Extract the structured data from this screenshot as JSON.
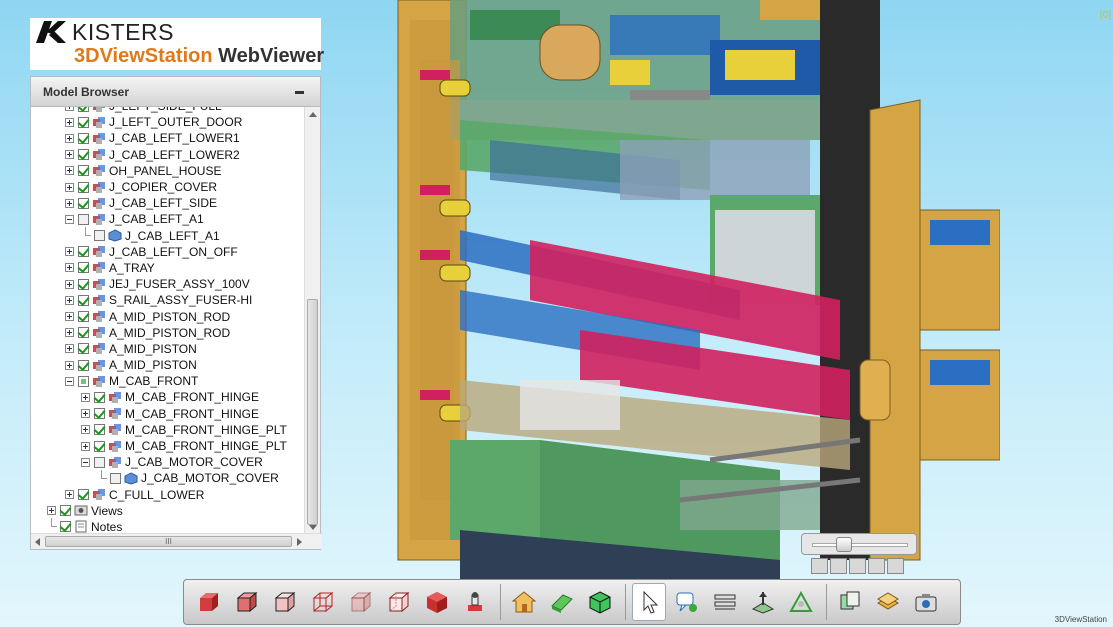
{
  "logo": {
    "brand": "KISTERS",
    "product_part1": "3DViewStation",
    "product_part2": " WebViewer"
  },
  "model_browser": {
    "title": "Model Browser",
    "items": [
      {
        "label": "J_LEFT_SIDE_FULL",
        "depth": 0,
        "expander": "plus",
        "check": "on",
        "icon": "assembly-icon"
      },
      {
        "label": "J_LEFT_OUTER_DOOR",
        "depth": 0,
        "expander": "plus",
        "check": "on",
        "icon": "assembly-icon"
      },
      {
        "label": "J_CAB_LEFT_LOWER1",
        "depth": 0,
        "expander": "plus",
        "check": "on",
        "icon": "assembly-icon"
      },
      {
        "label": "J_CAB_LEFT_LOWER2",
        "depth": 0,
        "expander": "plus",
        "check": "on",
        "icon": "assembly-icon"
      },
      {
        "label": "OH_PANEL_HOUSE",
        "depth": 0,
        "expander": "plus",
        "check": "on",
        "icon": "assembly-icon"
      },
      {
        "label": "J_COPIER_COVER",
        "depth": 0,
        "expander": "plus",
        "check": "on",
        "icon": "assembly-icon"
      },
      {
        "label": "J_CAB_LEFT_SIDE",
        "depth": 0,
        "expander": "plus",
        "check": "on",
        "icon": "assembly-icon"
      },
      {
        "label": "J_CAB_LEFT_A1",
        "depth": 0,
        "expander": "minus",
        "check": "off",
        "icon": "assembly-icon"
      },
      {
        "label": "J_CAB_LEFT_A1",
        "depth": 1,
        "expander": "leaf",
        "check": "off",
        "icon": "part-icon"
      },
      {
        "label": "J_CAB_LEFT_ON_OFF",
        "depth": 0,
        "expander": "plus",
        "check": "on",
        "icon": "assembly-icon"
      },
      {
        "label": "A_TRAY",
        "depth": 0,
        "expander": "plus",
        "check": "on",
        "icon": "assembly-icon"
      },
      {
        "label": "JEJ_FUSER_ASSY_100V",
        "depth": 0,
        "expander": "plus",
        "check": "on",
        "icon": "assembly-icon"
      },
      {
        "label": "S_RAIL_ASSY_FUSER-HI",
        "depth": 0,
        "expander": "plus",
        "check": "on",
        "icon": "assembly-icon"
      },
      {
        "label": "A_MID_PISTON_ROD",
        "depth": 0,
        "expander": "plus",
        "check": "on",
        "icon": "assembly-icon"
      },
      {
        "label": "A_MID_PISTON_ROD",
        "depth": 0,
        "expander": "plus",
        "check": "on",
        "icon": "assembly-icon"
      },
      {
        "label": "A_MID_PISTON",
        "depth": 0,
        "expander": "plus",
        "check": "on",
        "icon": "assembly-icon"
      },
      {
        "label": "A_MID_PISTON",
        "depth": 0,
        "expander": "plus",
        "check": "on",
        "icon": "assembly-icon"
      },
      {
        "label": "M_CAB_FRONT",
        "depth": 0,
        "expander": "minus",
        "check": "partial",
        "icon": "assembly-icon"
      },
      {
        "label": "M_CAB_FRONT_HINGE",
        "depth": 1,
        "expander": "plus",
        "check": "on",
        "icon": "assembly-icon"
      },
      {
        "label": "M_CAB_FRONT_HINGE",
        "depth": 1,
        "expander": "plus",
        "check": "on",
        "icon": "assembly-icon"
      },
      {
        "label": "M_CAB_FRONT_HINGE_PLT",
        "depth": 1,
        "expander": "plus",
        "check": "on",
        "icon": "assembly-icon"
      },
      {
        "label": "M_CAB_FRONT_HINGE_PLT",
        "depth": 1,
        "expander": "plus",
        "check": "on",
        "icon": "assembly-icon"
      },
      {
        "label": "J_CAB_MOTOR_COVER",
        "depth": 1,
        "expander": "minus",
        "check": "off",
        "icon": "assembly-icon"
      },
      {
        "label": "J_CAB_MOTOR_COVER",
        "depth": 2,
        "expander": "leaf",
        "check": "off",
        "icon": "part-icon"
      },
      {
        "label": "C_FULL_LOWER",
        "depth": 0,
        "expander": "plus",
        "check": "on",
        "icon": "assembly-icon"
      },
      {
        "label": "Views",
        "depth": -1,
        "expander": "plus",
        "check": "on",
        "icon": "views-icon"
      },
      {
        "label": "Notes",
        "depth": -1,
        "expander": "leaf",
        "check": "on",
        "icon": "notes-icon"
      }
    ],
    "hscroll_grip": "III"
  },
  "toolbar": {
    "buttons": [
      {
        "name": "shaded-view-icon",
        "group": 1
      },
      {
        "name": "shaded-edges-view-icon",
        "group": 1
      },
      {
        "name": "hidden-line-view-icon",
        "group": 1
      },
      {
        "name": "wireframe-view-icon",
        "group": 1
      },
      {
        "name": "transparent-view-icon",
        "group": 1
      },
      {
        "name": "wireframe-hidden-view-icon",
        "group": 1
      },
      {
        "name": "solid-red-cube-icon",
        "group": 1
      },
      {
        "name": "illustration-view-icon",
        "group": 1
      },
      {
        "name": "home-icon",
        "group": 2
      },
      {
        "name": "fit-view-icon",
        "group": 2
      },
      {
        "name": "box-view-icon",
        "group": 2
      },
      {
        "name": "select-cursor-icon",
        "group": 3,
        "active": true
      },
      {
        "name": "annotation-icon",
        "group": 3
      },
      {
        "name": "measure-icon",
        "group": 3
      },
      {
        "name": "section-icon",
        "group": 3
      },
      {
        "name": "explode-icon",
        "group": 3
      },
      {
        "name": "model-copy-icon",
        "group": 4
      },
      {
        "name": "layers-icon",
        "group": 4
      },
      {
        "name": "screenshot-icon",
        "group": 4
      }
    ]
  },
  "zoom": {
    "level": 0.3
  },
  "watermark": "3DViewStation",
  "corner_label": "[0]",
  "colors": {
    "accent": "#e07a18",
    "check_green": "#1a9a1a",
    "cabinet_tan": "#d5a545",
    "part_green": "#5ba86a",
    "part_blue": "#2b6fc2",
    "part_magenta": "#d0205e"
  }
}
